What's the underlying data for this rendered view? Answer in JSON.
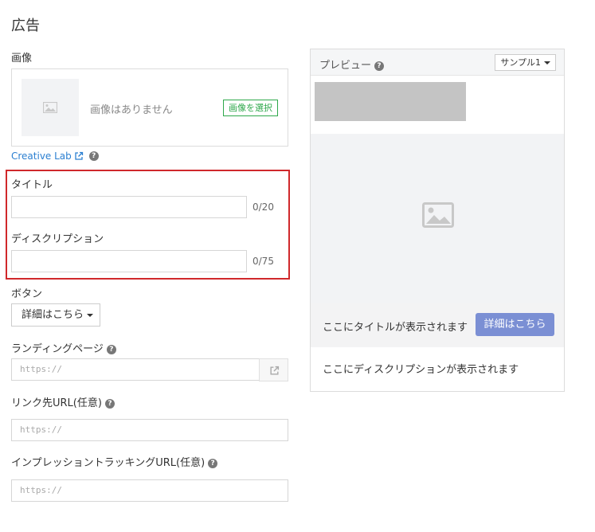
{
  "section_title": "広告",
  "image": {
    "label": "画像",
    "empty_text": "画像はありません",
    "select_button": "画像を選択"
  },
  "creative_lab": {
    "link": "Creative Lab"
  },
  "title_field": {
    "label": "タイトル",
    "value": "",
    "counter": "0/20"
  },
  "description_field": {
    "label": "ディスクリプション",
    "value": "",
    "counter": "0/75"
  },
  "button_field": {
    "label": "ボタン",
    "selected": "詳細はこちら"
  },
  "landing_page": {
    "label": "ランディングページ",
    "placeholder": "https://"
  },
  "link_url": {
    "label": "リンク先URL(任意)",
    "placeholder": "https://"
  },
  "tracking_url": {
    "label": "インプレッショントラッキングURL(任意)",
    "placeholder": "https://"
  },
  "preview": {
    "title": "プレビュー",
    "sample_selected": "サンプル1",
    "title_placeholder": "ここにタイトルが表示されます",
    "button_label": "詳細はこちら",
    "description_placeholder": "ここにディスクリプションが表示されます"
  },
  "colors": {
    "accent_green": "#2ea84b",
    "link_blue": "#2b7fd1",
    "highlight_red": "#d0282b",
    "preview_button": "#7b8fd4"
  }
}
